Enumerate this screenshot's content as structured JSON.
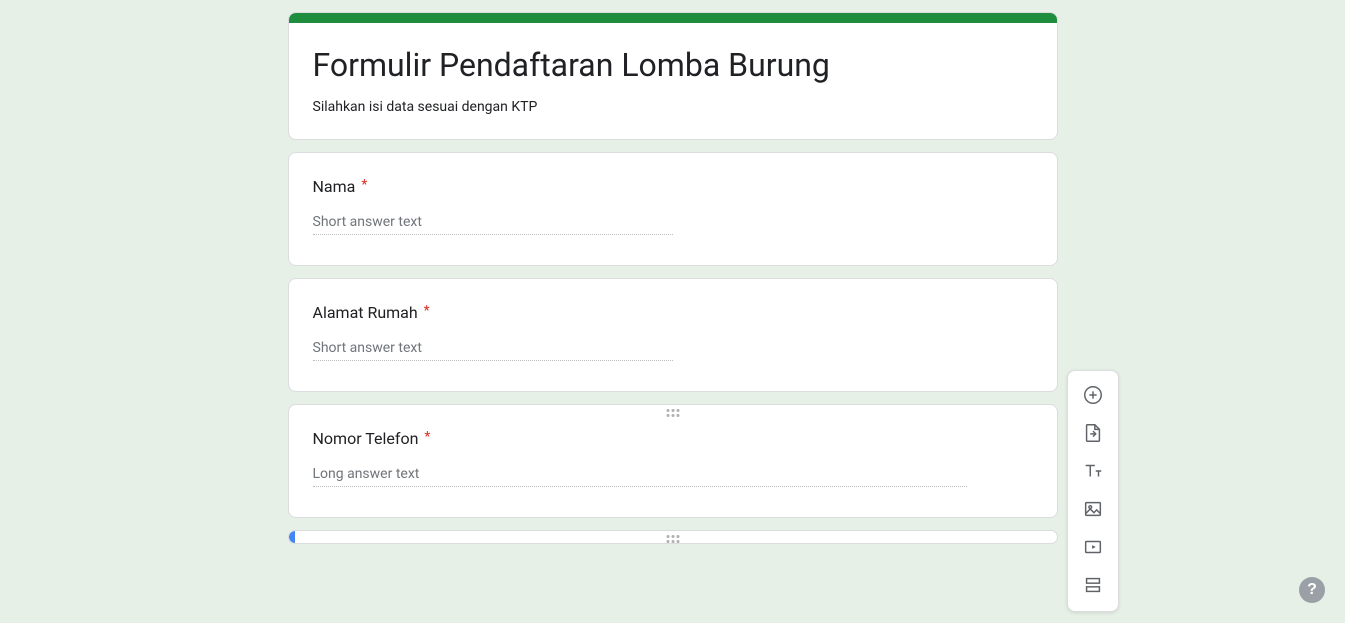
{
  "form": {
    "title": "Formulir Pendaftaran Lomba Burung",
    "description": "Silahkan isi data sesuai dengan KTP"
  },
  "questions": [
    {
      "label": "Nama",
      "required": true,
      "placeholder": "Short answer text",
      "type": "short"
    },
    {
      "label": "Alamat Rumah",
      "required": true,
      "placeholder": "Short answer text",
      "type": "short"
    },
    {
      "label": "Nomor Telefon",
      "required": true,
      "placeholder": "Long answer text",
      "type": "long"
    }
  ],
  "toolbar": {
    "add_question": "Add question",
    "import_questions": "Import questions",
    "add_title": "Add title and description",
    "add_image": "Add image",
    "add_video": "Add video",
    "add_section": "Add section"
  },
  "help": {
    "label": "?"
  },
  "required_marker": "*"
}
